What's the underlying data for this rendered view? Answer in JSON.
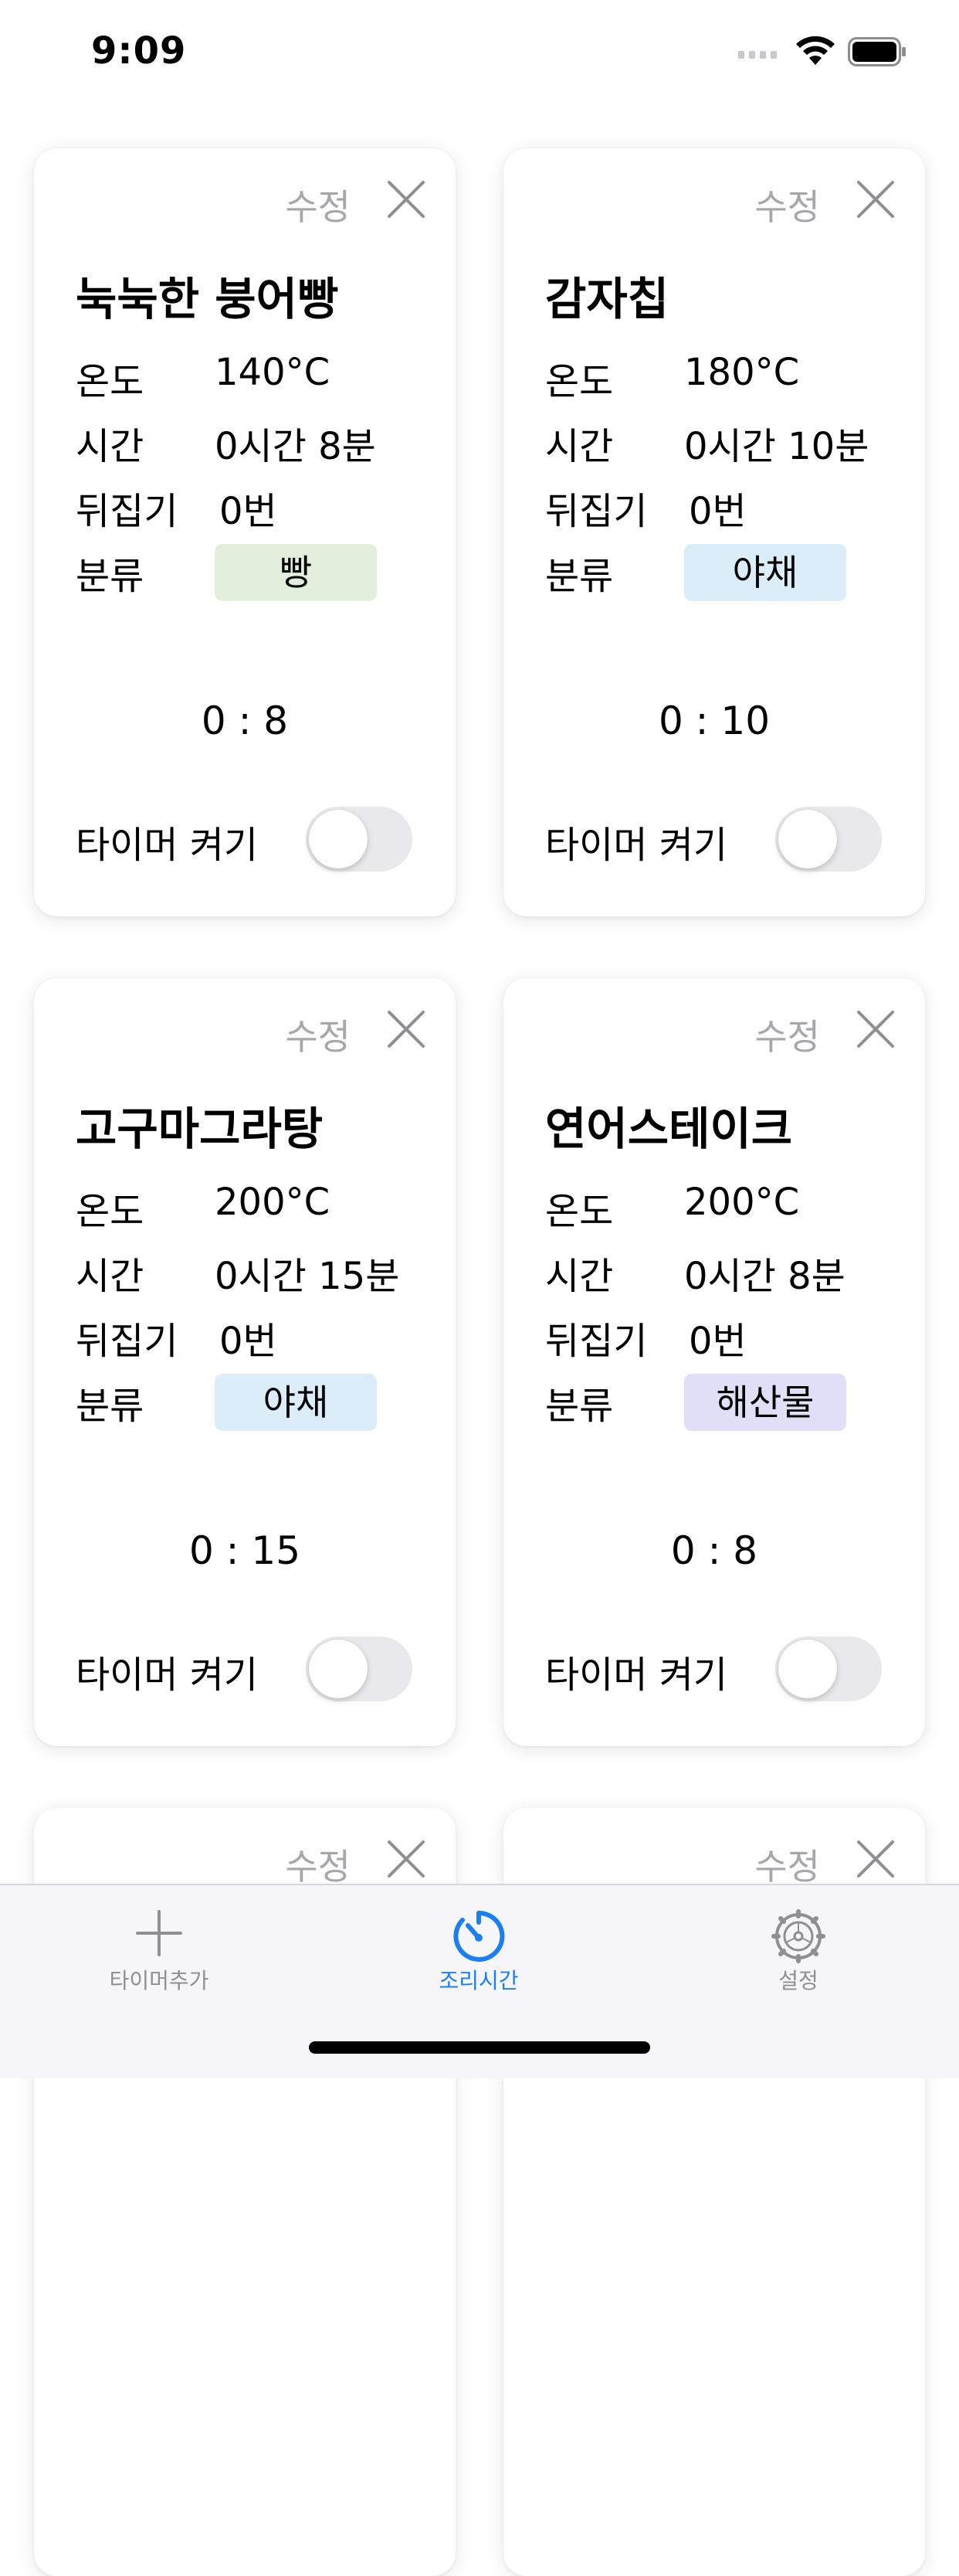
{
  "status_bar": {
    "time": "9:09"
  },
  "cards": [
    {
      "title": "눅눅한 붕어빵",
      "temp_label": "온도",
      "temp": "140°C",
      "time_label": "시간",
      "time": "0시간 8분",
      "flip_label": "뒤집기",
      "flip": "0번",
      "category_label": "분류",
      "category": "빵",
      "category_color": "#e2efdc",
      "countdown": "0 : 8",
      "edit_label": "수정",
      "timer_label": "타이머 켜기"
    },
    {
      "title": "감자칩",
      "temp_label": "온도",
      "temp": "180°C",
      "time_label": "시간",
      "time": "0시간 10분",
      "flip_label": "뒤집기",
      "flip": "0번",
      "category_label": "분류",
      "category": "야채",
      "category_color": "#dcedfa",
      "countdown": "0 : 10",
      "edit_label": "수정",
      "timer_label": "타이머 켜기"
    },
    {
      "title": "고구마그라탕",
      "temp_label": "온도",
      "temp": "200°C",
      "time_label": "시간",
      "time": "0시간 15분",
      "flip_label": "뒤집기",
      "flip": "0번",
      "category_label": "분류",
      "category": "야채",
      "category_color": "#dcedfa",
      "countdown": "0 : 15",
      "edit_label": "수정",
      "timer_label": "타이머 켜기"
    },
    {
      "title": "연어스테이크",
      "temp_label": "온도",
      "temp": "200°C",
      "time_label": "시간",
      "time": "0시간 8분",
      "flip_label": "뒤집기",
      "flip": "0번",
      "category_label": "분류",
      "category": "해산물",
      "category_color": "#dfe0f7",
      "countdown": "0 : 8",
      "edit_label": "수정",
      "timer_label": "타이머 켜기"
    },
    {
      "edit_label": "수정"
    },
    {
      "edit_label": "수정"
    }
  ],
  "tabs": [
    {
      "label": "타이머추가",
      "icon": "plus-icon",
      "active": false
    },
    {
      "label": "조리시간",
      "icon": "timer-icon",
      "active": true
    },
    {
      "label": "설정",
      "icon": "gear-icon",
      "active": false
    }
  ],
  "colors": {
    "accent": "#1a7ff5",
    "inactive": "#8e8e93",
    "toggle_off": "#e9e9eb"
  }
}
